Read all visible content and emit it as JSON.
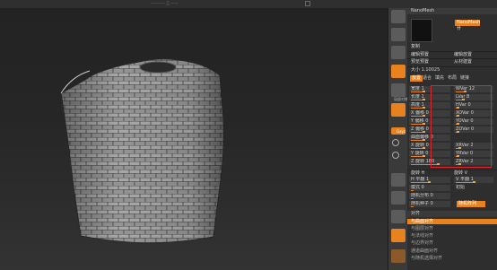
{
  "topbar": {
    "text": "———— 乙 ——"
  },
  "tool": {
    "name": "NanoMesh",
    "nano_button": "NanoMesh 卄",
    "props": [
      {
        "left": "复制",
        "right": ""
      },
      {
        "left": "编辑预置",
        "right": "编辑放置"
      },
      {
        "left": "预览预置",
        "right": "从材建置"
      }
    ],
    "size_label": "大小 1.10025"
  },
  "tabs": [
    {
      "label": "放置",
      "active": true
    },
    {
      "label": "适合",
      "active": false
    },
    {
      "label": "填充",
      "active": false
    },
    {
      "label": "布局",
      "active": false
    },
    {
      "label": "链接",
      "active": false
    }
  ],
  "params": [
    {
      "left": "宽度 1",
      "right": "WVar 12"
    },
    {
      "left": "长度 1",
      "right": "LVar 8"
    },
    {
      "left": "高度 1",
      "right": "HVar 0"
    },
    {
      "left": "X 偏移 0",
      "right": "XOVar 0"
    },
    {
      "left": "Y 偏移 0",
      "right": "YOVar 0"
    },
    {
      "left": "Z 偏移 0",
      "right": "ZOVar 0"
    },
    {
      "left": "曲面偏移 0",
      "right": ""
    },
    {
      "left": "X 旋转 0",
      "right": "XRVar 2"
    },
    {
      "left": "Y 旋转 0",
      "right": "YRVar 0"
    },
    {
      "left": "Z 旋转 180",
      "right": "ZRVar 2"
    }
  ],
  "after_params": {
    "rot_label": "旋转 H",
    "rot_right": "旋转 V",
    "h_flip": "H 平翻 1",
    "v_flip": "V 平翻 1",
    "pattern": "模式 0",
    "pattern_right": "初始",
    "seed": "随机分布 0",
    "seed_btn": "",
    "rand_seed": "随机种子 0",
    "rand_btn": "随机阵列"
  },
  "align_section": {
    "title": "对齐",
    "items": [
      {
        "label": "与曲面对齐",
        "active": true
      },
      {
        "label": "与图层对齐",
        "active": false
      },
      {
        "label": "与法线对齐",
        "active": false
      },
      {
        "label": "与边界对齐",
        "active": false
      },
      {
        "label": "通道曲面对齐",
        "active": false
      },
      {
        "label": "与随机选择对齐",
        "active": false
      }
    ]
  },
  "icons": [
    {
      "name": "poly-icon",
      "style": "grey",
      "label": ""
    },
    {
      "name": "transp-icon",
      "style": "grey",
      "label": ""
    },
    {
      "name": "ghost-icon",
      "style": "grey",
      "label": ""
    },
    {
      "name": "persp-icon",
      "style": "grey",
      "label": ""
    },
    {
      "name": "floor-icon",
      "style": "orange",
      "label": "透视"
    },
    {
      "name": "lsym-icon",
      "style": "grey",
      "label": "局部对称"
    },
    {
      "name": "frame-icon",
      "style": "orange",
      "label": ""
    },
    {
      "name": "xyz-icon",
      "style": "orange",
      "label": "Gxyz"
    },
    {
      "name": "move-icon",
      "style": "grey",
      "label": ""
    },
    {
      "name": "scale-icon",
      "style": "grey",
      "label": ""
    },
    {
      "name": "rotate-icon",
      "style": "grey",
      "label": ""
    },
    {
      "name": "polyf-icon",
      "style": "grey",
      "label": ""
    },
    {
      "name": "solo-icon",
      "style": "orange",
      "label": ""
    }
  ]
}
